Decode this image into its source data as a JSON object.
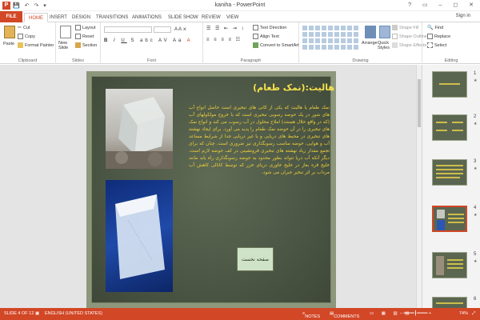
{
  "window": {
    "title": "kaniha - PowerPoint",
    "app_icon": "P",
    "qat": "💾 ↶ ↷ ▾",
    "controls": "? ▭ – ◻ ✕"
  },
  "tabs": {
    "file": "FILE",
    "items": [
      "HOME",
      "INSERT",
      "DESIGN",
      "TRANSITIONS",
      "ANIMATIONS",
      "SLIDE SHOW",
      "REVIEW",
      "VIEW"
    ],
    "sign_in": "Sign in"
  },
  "ribbon": {
    "clipboard": {
      "label": "Clipboard",
      "paste": "Paste",
      "cut": "Cut",
      "copy": "Copy",
      "format_painter": "Format Painter"
    },
    "slides": {
      "label": "Slides",
      "new_slide": "New Slide",
      "layout": "Layout",
      "reset": "Reset",
      "section": "Section"
    },
    "font": {
      "label": "Font"
    },
    "paragraph": {
      "label": "Paragraph",
      "text_direction": "Text Direction",
      "align_text": "Align Text",
      "convert_smartart": "Convert to SmartArt"
    },
    "drawing": {
      "label": "Drawing",
      "arrange": "Arrange",
      "quick_styles": "Quick Styles",
      "shape_fill": "Shape Fill",
      "shape_outline": "Shape Outline",
      "shape_effects": "Shape Effects"
    },
    "editing": {
      "label": "Editing",
      "find": "Find",
      "replace": "Replace",
      "select": "Select"
    }
  },
  "slide": {
    "title": "هالیت:(نمک طعام)",
    "body": "نمک طعام یا هالیت که یکی از کانی های تبخیری است حاصل انواع آب های شور در یک حوضه رسوبی تبخیری است که با خروج مولکولهای آب (که در واقع حلال هستند) املاح محلول در آب رسوب می کند و انواع نمک های تبخیری را در آن حوضه نمک طعام را پدید می آورد. برای ایجاد نهشته های تبخیری در محیط های دریایی و یا غیر دریایی جدا از شرایط مساعد آب و هوایی، حوضه مناسب رسوبگذاری نیز ضروری است. چنان که برای تجمع مقدار زیاد نهشته های تبخیری فرونشینی در کف حوضه لازم است. دیگر آنکه آب دریا نتواند بطور محدود به حوضه رسوبگذاری راه یابد مانند خلیج قره بغاز در خلیج خاوری دریای خزر که توسط کانالی کاهش آب مرداب بر اثر تبخیر جبران می شود.",
    "page_label": "صفحه نخست"
  },
  "thumbnails": [
    {
      "number": "1",
      "star": "★"
    },
    {
      "number": "2",
      "star": "★"
    },
    {
      "number": "3",
      "star": "★"
    },
    {
      "number": "4",
      "star": "★"
    },
    {
      "number": "5",
      "star": "★"
    },
    {
      "number": "6",
      "star": "★"
    }
  ],
  "status": {
    "slide_info": "SLIDE 4 OF 12",
    "language": "ENGLISH (UNITED STATES)",
    "notes": "NOTES",
    "comments": "COMMENTS",
    "zoom": "74%"
  },
  "colors": {
    "accent": "#d24726",
    "slide_text": "#f3d23a",
    "slide_bg": "#4d5846"
  }
}
